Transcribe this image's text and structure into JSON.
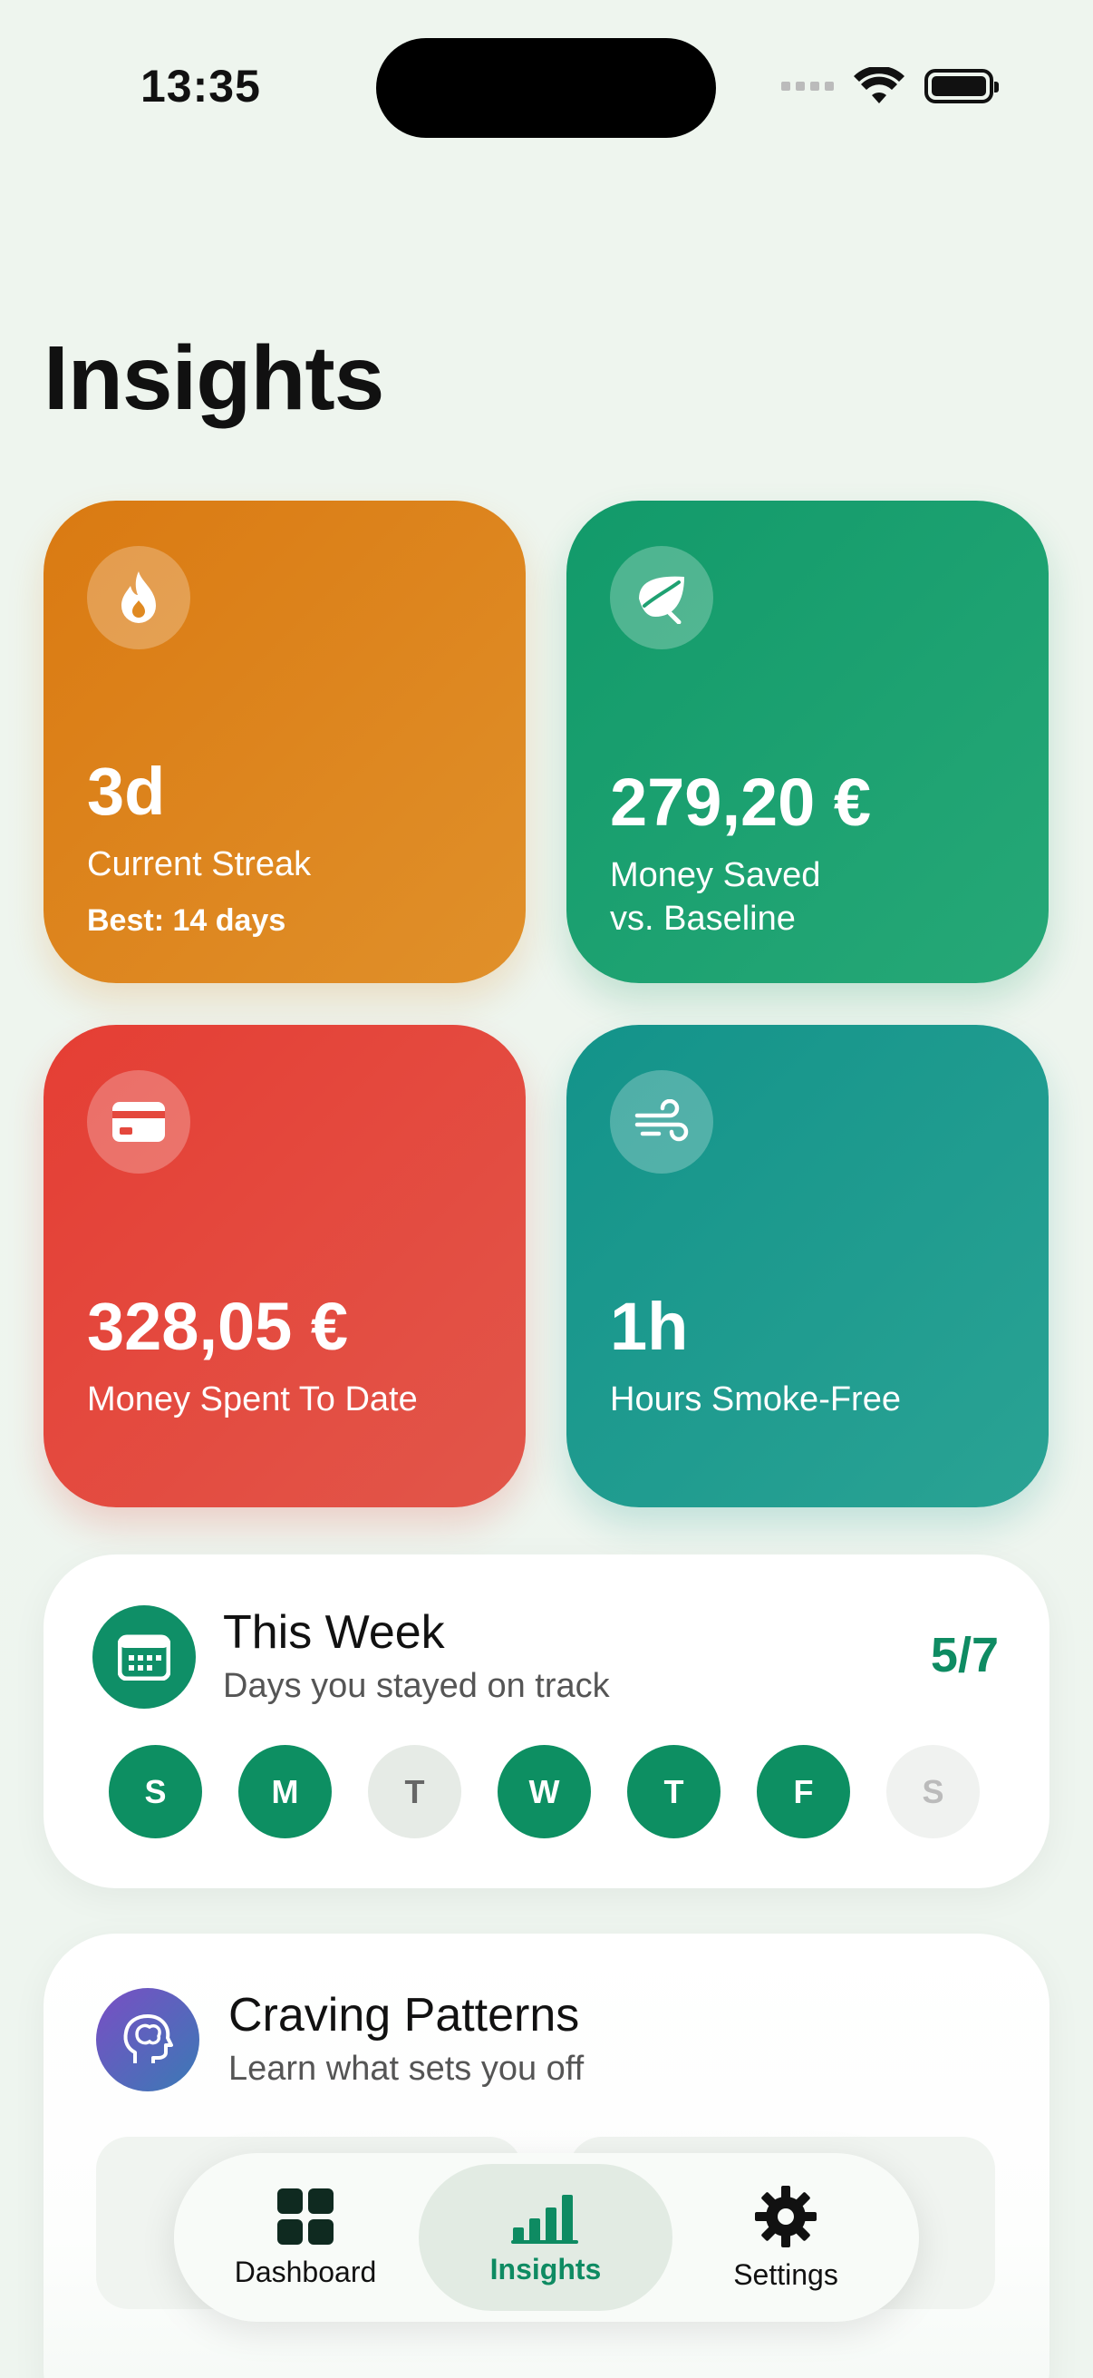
{
  "status": {
    "time": "13:35"
  },
  "page": {
    "title": "Insights"
  },
  "cards": {
    "streak": {
      "value": "3d",
      "label": "Current Streak",
      "sub": "Best: 14 days",
      "icon": "flame-icon"
    },
    "saved": {
      "value": "279,20 €",
      "label1": "Money Saved",
      "label2": "vs. Baseline",
      "icon": "leaf-icon"
    },
    "spent": {
      "value": "328,05 €",
      "label": "Money Spent To Date",
      "icon": "credit-card-icon"
    },
    "hours": {
      "value": "1h",
      "label": "Hours Smoke-Free",
      "icon": "wind-icon"
    }
  },
  "week": {
    "title": "This Week",
    "subtitle": "Days you stayed on track",
    "count": "5/7",
    "days": [
      {
        "letter": "S",
        "state": "on"
      },
      {
        "letter": "M",
        "state": "on"
      },
      {
        "letter": "T",
        "state": "off"
      },
      {
        "letter": "W",
        "state": "on"
      },
      {
        "letter": "T",
        "state": "on"
      },
      {
        "letter": "F",
        "state": "on"
      },
      {
        "letter": "S",
        "state": "dim"
      }
    ]
  },
  "craving": {
    "title": "Craving Patterns",
    "subtitle": "Learn what sets you off"
  },
  "tabs": {
    "dashboard": "Dashboard",
    "insights": "Insights",
    "settings": "Settings"
  },
  "colors": {
    "accent": "#0e8b62",
    "streak": "#da7a12",
    "saved": "#129a6a",
    "spent": "#e53e34",
    "hours": "#13938a"
  }
}
